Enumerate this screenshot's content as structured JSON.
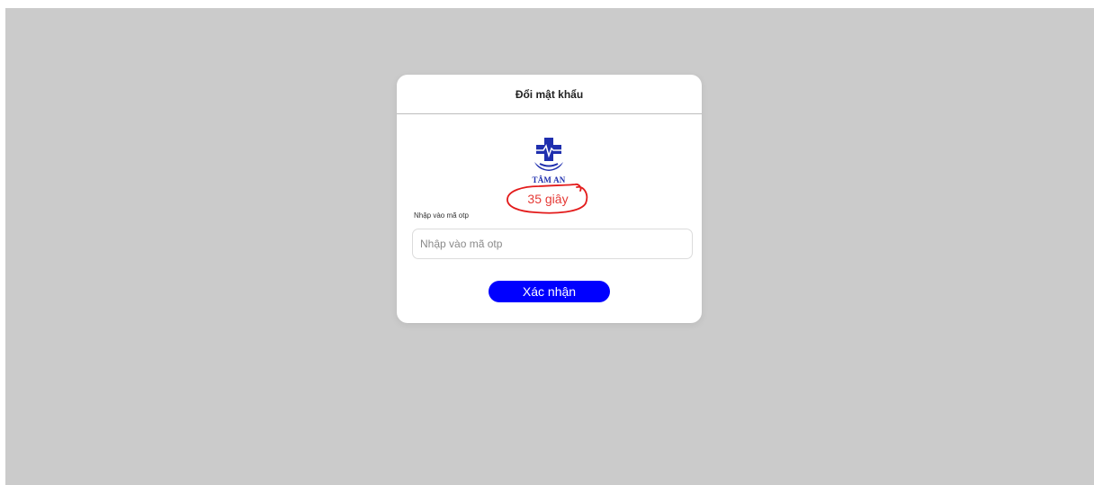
{
  "modal": {
    "title": "Đổi mật khẩu",
    "logo_text": "TÂM AN",
    "countdown": "35 giây"
  },
  "otp": {
    "label": "Nhập vào mã otp",
    "placeholder": "Nhập vào mã otp",
    "value": ""
  },
  "actions": {
    "confirm_label": "Xác nhận"
  },
  "colors": {
    "backdrop": "#cbcbcb",
    "accent": "#0000ff",
    "countdown": "#e53935",
    "logo": "#1f2fae"
  },
  "icons": {
    "logo": "medical-cross-hand-logo",
    "annotation": "red-hand-drawn-circle"
  }
}
